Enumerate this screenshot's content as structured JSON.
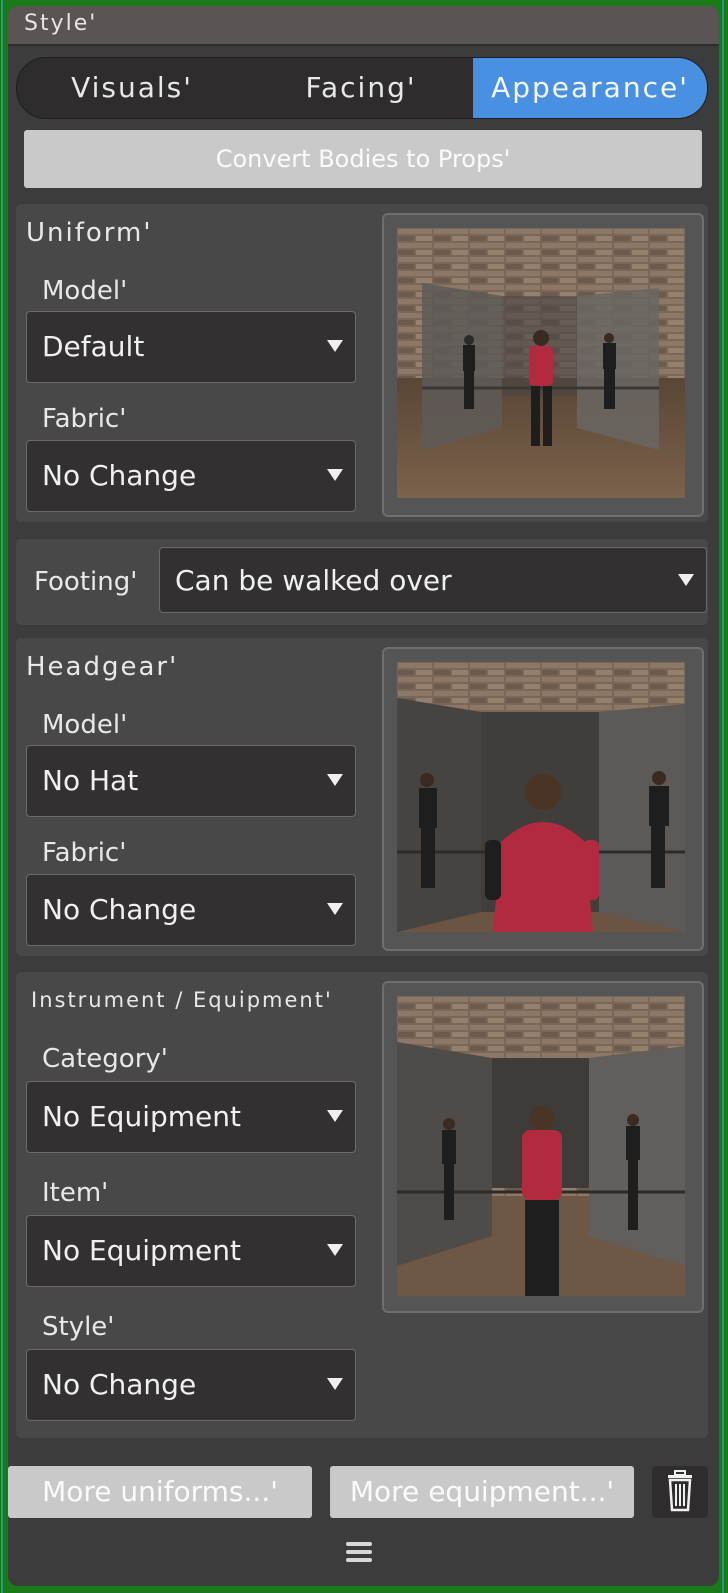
{
  "window": {
    "title": "Style'"
  },
  "tabs": [
    {
      "label": "Visuals'",
      "active": false
    },
    {
      "label": "Facing'",
      "active": false
    },
    {
      "label": "Appearance'",
      "active": true
    }
  ],
  "convert_button": "Convert Bodies to Props'",
  "uniform": {
    "title": "Uniform'",
    "model_label": "Model'",
    "model_value": "Default",
    "fabric_label": "Fabric'",
    "fabric_value": "No Change"
  },
  "footing": {
    "label": "Footing'",
    "value": "Can be walked over"
  },
  "headgear": {
    "title": "Headgear'",
    "model_label": "Model'",
    "model_value": "No Hat",
    "fabric_label": "Fabric'",
    "fabric_value": "No Change"
  },
  "equipment": {
    "title": "Instrument / Equipment'",
    "category_label": "Category'",
    "category_value": "No Equipment",
    "item_label": "Item'",
    "item_value": "No Equipment",
    "style_label": "Style'",
    "style_value": "No Change"
  },
  "bottom": {
    "more_uniforms": "More uniforms...'",
    "more_equipment": "More equipment...'"
  },
  "icons": [
    "trash-icon",
    "menu-icon",
    "dropdown-caret-icon"
  ],
  "colors": {
    "accent": "#4a90e2",
    "panel": "#3c3c3c",
    "section": "#484848",
    "button": "#c9c9c9",
    "dropdown": "#323030"
  }
}
